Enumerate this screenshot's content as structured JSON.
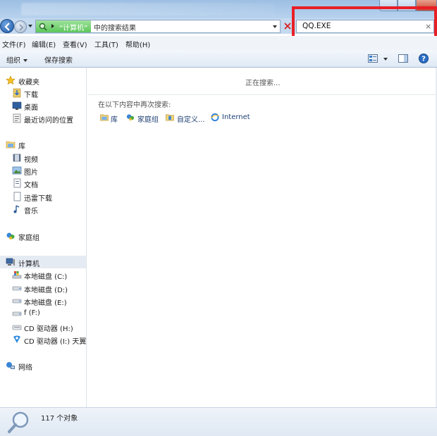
{
  "address": {
    "location": "“计算机”",
    "suffix": "中的搜索结果"
  },
  "search": {
    "query": "QQ.EXE",
    "clear_glyph": "×"
  },
  "menu": {
    "file": "文件(F)",
    "edit": "编辑(E)",
    "view": "查看(V)",
    "tools": "工具(T)",
    "help": "帮助(H)"
  },
  "toolbar": {
    "organize": "组织",
    "save_search": "保存搜索",
    "help_glyph": "?"
  },
  "sidebar": {
    "favorites": {
      "title": "收藏夹",
      "items": [
        "下载",
        "桌面",
        "最近访问的位置"
      ]
    },
    "libraries": {
      "title": "库",
      "items": [
        "视频",
        "图片",
        "文档",
        "迅雷下载",
        "音乐"
      ]
    },
    "homegroup": "家庭组",
    "computer": {
      "title": "计算机",
      "items": [
        "本地磁盘 (C:)",
        "本地磁盘 (D:)",
        "本地磁盘 (E:)",
        "f (F:)",
        "CD 驱动器 (H:)",
        "CD 驱动器 (I:) 天翼"
      ]
    },
    "network": "网络"
  },
  "main": {
    "status": "正在搜索...",
    "search_again_label": "在以下内容中再次搜索:",
    "locations": [
      "库",
      "家庭组",
      "自定义...",
      "Internet"
    ]
  },
  "statusbar": {
    "count": "117 个对象"
  },
  "colors": {
    "highlight": "#e81f26",
    "link": "#1e3f73",
    "address_green": "#5cc65a"
  }
}
